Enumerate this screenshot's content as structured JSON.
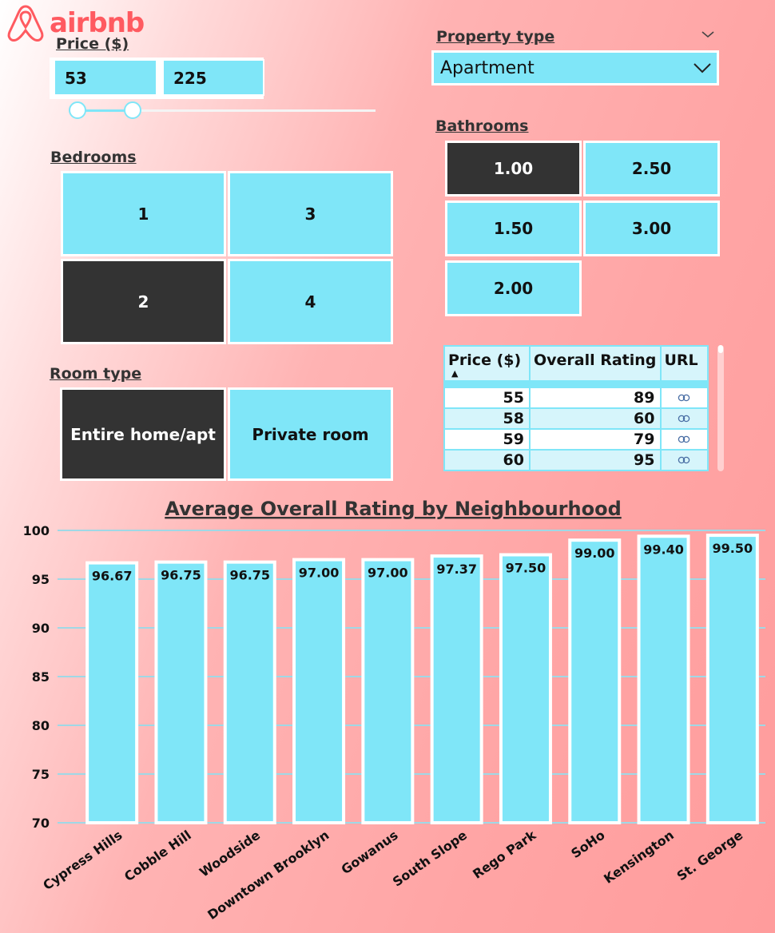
{
  "brand": {
    "name": "airbnb",
    "color": "#ff5a60"
  },
  "price_filter": {
    "title": "Price ($)",
    "min": "53",
    "max": "225"
  },
  "property_filter": {
    "title": "Property type",
    "selected": "Apartment"
  },
  "bathrooms": {
    "title": "Bathrooms",
    "options": [
      {
        "label": "1.00",
        "selected": true
      },
      {
        "label": "2.50",
        "selected": false
      },
      {
        "label": "1.50",
        "selected": false
      },
      {
        "label": "3.00",
        "selected": false
      },
      {
        "label": "2.00",
        "selected": false
      }
    ]
  },
  "bedrooms": {
    "title": "Bedrooms",
    "options": [
      {
        "label": "1",
        "selected": false
      },
      {
        "label": "3",
        "selected": false
      },
      {
        "label": "2",
        "selected": true
      },
      {
        "label": "4",
        "selected": false
      }
    ]
  },
  "room_type": {
    "title": "Room type",
    "options": [
      {
        "label": "Entire home/apt",
        "selected": true
      },
      {
        "label": "Private room",
        "selected": false
      }
    ]
  },
  "table": {
    "columns": [
      "Price ($)",
      "Overall Rating",
      "URL"
    ],
    "rows": [
      {
        "price": "55",
        "rating": "89",
        "url_icon": "link-icon"
      },
      {
        "price": "58",
        "rating": "60",
        "url_icon": "link-icon"
      },
      {
        "price": "59",
        "rating": "79",
        "url_icon": "link-icon"
      },
      {
        "price": "60",
        "rating": "95",
        "url_icon": "link-icon"
      }
    ]
  },
  "colors": {
    "accent": "#7fe6f8",
    "selected": "#333333",
    "grid": "#9fd8e6"
  },
  "chart_data": {
    "type": "bar",
    "title": "Average Overall Rating by Neighbourhood",
    "categories": [
      "Cypress Hills",
      "Cobble Hill",
      "Woodside",
      "Downtown Brooklyn",
      "Gowanus",
      "South Slope",
      "Rego Park",
      "SoHo",
      "Kensington",
      "St. George"
    ],
    "values": [
      96.67,
      96.75,
      96.75,
      97.0,
      97.0,
      97.37,
      97.5,
      99.0,
      99.4,
      99.5
    ],
    "data_labels": [
      "96.67",
      "96.75",
      "96.75",
      "97.00",
      "97.00",
      "97.37",
      "97.50",
      "99.00",
      "99.40",
      "99.50"
    ],
    "ylim": [
      70,
      100
    ],
    "yticks": [
      "70",
      "75",
      "80",
      "85",
      "90",
      "95",
      "100"
    ],
    "grid": true
  }
}
